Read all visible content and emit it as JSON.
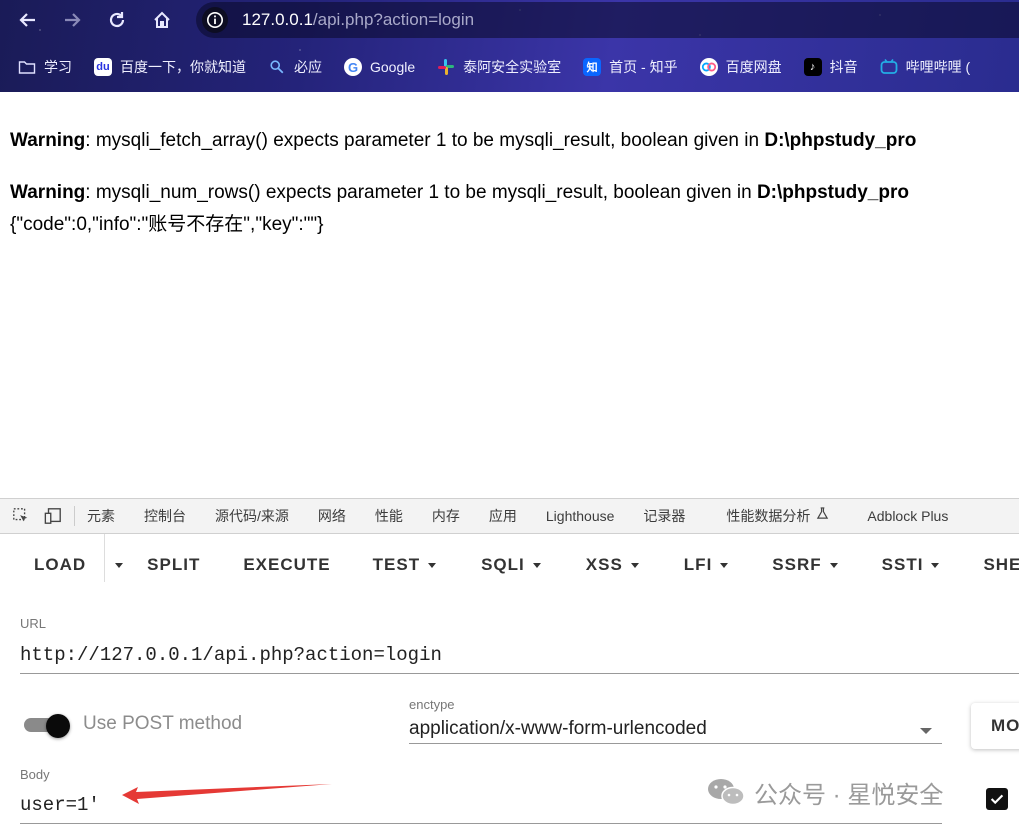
{
  "browser": {
    "url_host": "127.0.0.1",
    "url_path": "/api.php?action=login",
    "bookmarks": [
      {
        "label": "学习",
        "icon": "folder-icon"
      },
      {
        "label": "百度一下，你就知道",
        "icon": "baidu-icon"
      },
      {
        "label": "必应",
        "icon": "bing-search-icon"
      },
      {
        "label": "Google",
        "icon": "google-icon"
      },
      {
        "label": "泰阿安全实验室",
        "icon": "slack-like-icon"
      },
      {
        "label": "首页 - 知乎",
        "icon": "zhihu-icon"
      },
      {
        "label": "百度网盘",
        "icon": "baidu-netdisk-icon"
      },
      {
        "label": "抖音",
        "icon": "douyin-icon"
      },
      {
        "label": "哔哩哔哩 (",
        "icon": "bilibili-icon"
      }
    ]
  },
  "page": {
    "warnings": [
      {
        "label": "Warning",
        "text": ": mysqli_fetch_array() expects parameter 1 to be mysqli_result, boolean given in ",
        "path": "D:\\phpstudy_pro"
      },
      {
        "label": "Warning",
        "text": ": mysqli_num_rows() expects parameter 1 to be mysqli_result, boolean given in ",
        "path": "D:\\phpstudy_pro"
      }
    ],
    "json_output": "{\"code\":0,\"info\":\"账号不存在\",\"key\":\"\"}"
  },
  "devtools": {
    "tabs": [
      "元素",
      "控制台",
      "源代码/来源",
      "网络",
      "性能",
      "内存",
      "应用",
      "Lighthouse",
      "记录器",
      "性能数据分析",
      "Adblock Plus"
    ]
  },
  "hackbar": {
    "buttons": [
      {
        "label": "LOAD",
        "dropdown": false
      },
      {
        "label": "SPLIT",
        "dropdown": false
      },
      {
        "label": "EXECUTE",
        "dropdown": false
      },
      {
        "label": "TEST",
        "dropdown": true
      },
      {
        "label": "SQLI",
        "dropdown": true
      },
      {
        "label": "XSS",
        "dropdown": true
      },
      {
        "label": "LFI",
        "dropdown": true
      },
      {
        "label": "SSRF",
        "dropdown": true
      },
      {
        "label": "SSTI",
        "dropdown": true
      },
      {
        "label": "SHEL",
        "dropdown": false
      }
    ],
    "url_label": "URL",
    "url_value": "http://127.0.0.1/api.php?action=login",
    "post_label": "Use POST method",
    "post_enabled": true,
    "enctype_label": "enctype",
    "enctype_value": "application/x-www-form-urlencoded",
    "mode_button": "MO",
    "body_label": "Body",
    "body_value": "user=1'",
    "checkbox_checked": true
  },
  "watermark": "公众号 · 星悦安全",
  "colors": {
    "annotation_arrow": "#e53935",
    "chrome_bg": "#24237a"
  }
}
